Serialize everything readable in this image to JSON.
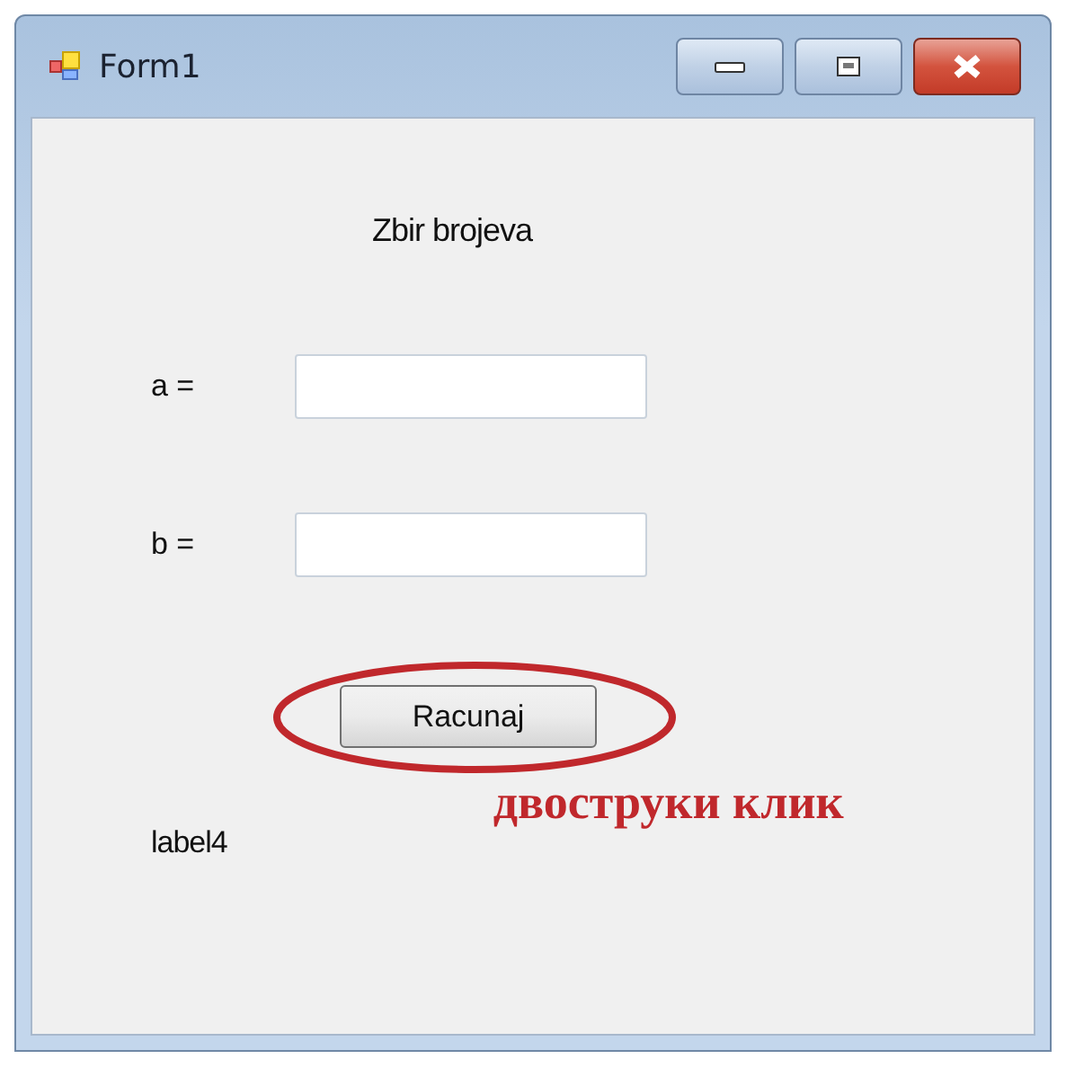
{
  "window": {
    "title": "Form1"
  },
  "heading": "Zbir brojeva",
  "fields": [
    {
      "label": "a ="
    },
    {
      "label": "b ="
    }
  ],
  "button": {
    "label": "Racunaj",
    "circled": true
  },
  "result_label": "label4",
  "annotation": "двоструки клик"
}
